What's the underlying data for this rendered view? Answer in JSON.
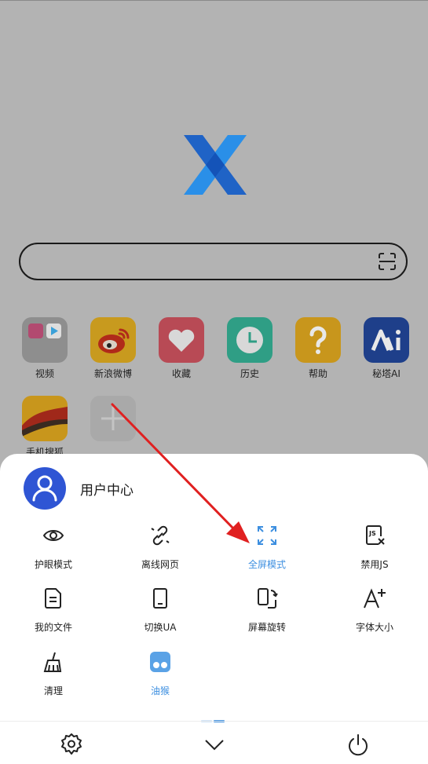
{
  "home": {
    "search": {
      "value": "",
      "placeholder": ""
    },
    "shortcuts": [
      {
        "label": "视频",
        "icon": "video-folder-icon",
        "color": "#8e8e8e"
      },
      {
        "label": "新浪微博",
        "icon": "weibo-icon",
        "color": "#c89a1e"
      },
      {
        "label": "收藏",
        "icon": "heart-icon",
        "color": "#b84a55"
      },
      {
        "label": "历史",
        "icon": "clock-icon",
        "color": "#2f9e85"
      },
      {
        "label": "帮助",
        "icon": "question-icon",
        "color": "#c8961c"
      },
      {
        "label": "秘塔AI",
        "icon": "metaso-icon",
        "color": "#1e3f8a"
      },
      {
        "label": "手机搜狐",
        "icon": "sohu-fox-icon",
        "color": "#c8961c"
      },
      {
        "label": "",
        "icon": "plus-icon",
        "color": "#a9a9a9"
      }
    ]
  },
  "sheet": {
    "user_center": "用户中心",
    "items": [
      {
        "label": "护眼模式",
        "icon": "eye-icon"
      },
      {
        "label": "离线网页",
        "icon": "offline-link-icon"
      },
      {
        "label": "全屏模式",
        "icon": "fullscreen-icon",
        "active": true
      },
      {
        "label": "禁用JS",
        "icon": "disable-js-icon"
      },
      {
        "label": "我的文件",
        "icon": "file-icon"
      },
      {
        "label": "切换UA",
        "icon": "phone-icon"
      },
      {
        "label": "屏幕旋转",
        "icon": "rotate-screen-icon"
      },
      {
        "label": "字体大小",
        "icon": "font-size-icon"
      },
      {
        "label": "清理",
        "icon": "broom-icon"
      },
      {
        "label": "油猴",
        "icon": "tampermonkey-icon",
        "active": true
      }
    ],
    "bottom": [
      "gear-icon",
      "chevron-down-icon",
      "power-icon"
    ]
  },
  "colors": {
    "accent": "#3d8fe0",
    "avatar": "#2f55d4",
    "arrow": "#e02020"
  }
}
